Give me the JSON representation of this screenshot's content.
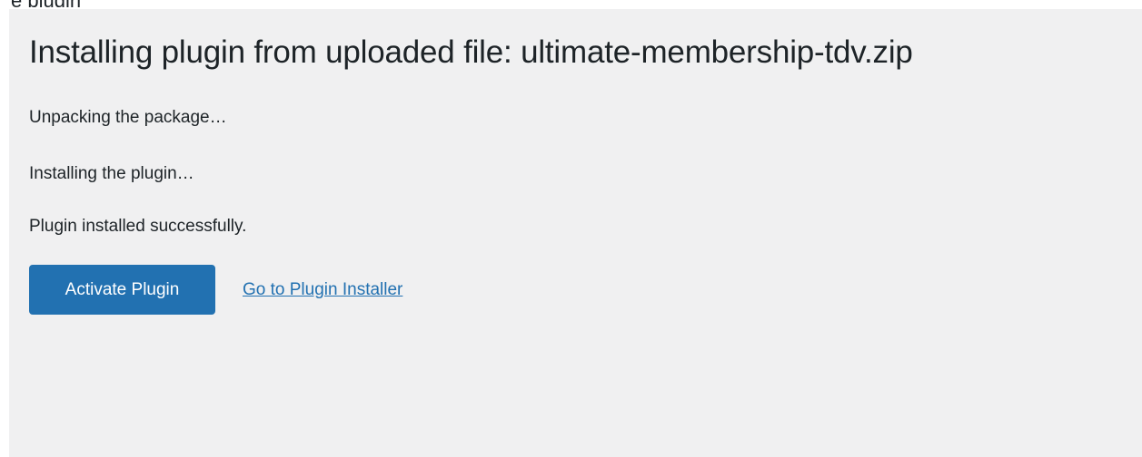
{
  "top_cropped_text": "e plugin",
  "install": {
    "title": "Installing plugin from uploaded file: ultimate-membership-tdv.zip",
    "messages": [
      "Unpacking the package…",
      "Installing the plugin…",
      "Plugin installed successfully."
    ],
    "actions": {
      "activate_label": "Activate Plugin",
      "installer_link_label": "Go to Plugin Installer"
    }
  },
  "colors": {
    "background": "#f0f0f1",
    "primary_button": "#2271b1",
    "link": "#2271b1",
    "text": "#1d2327"
  }
}
